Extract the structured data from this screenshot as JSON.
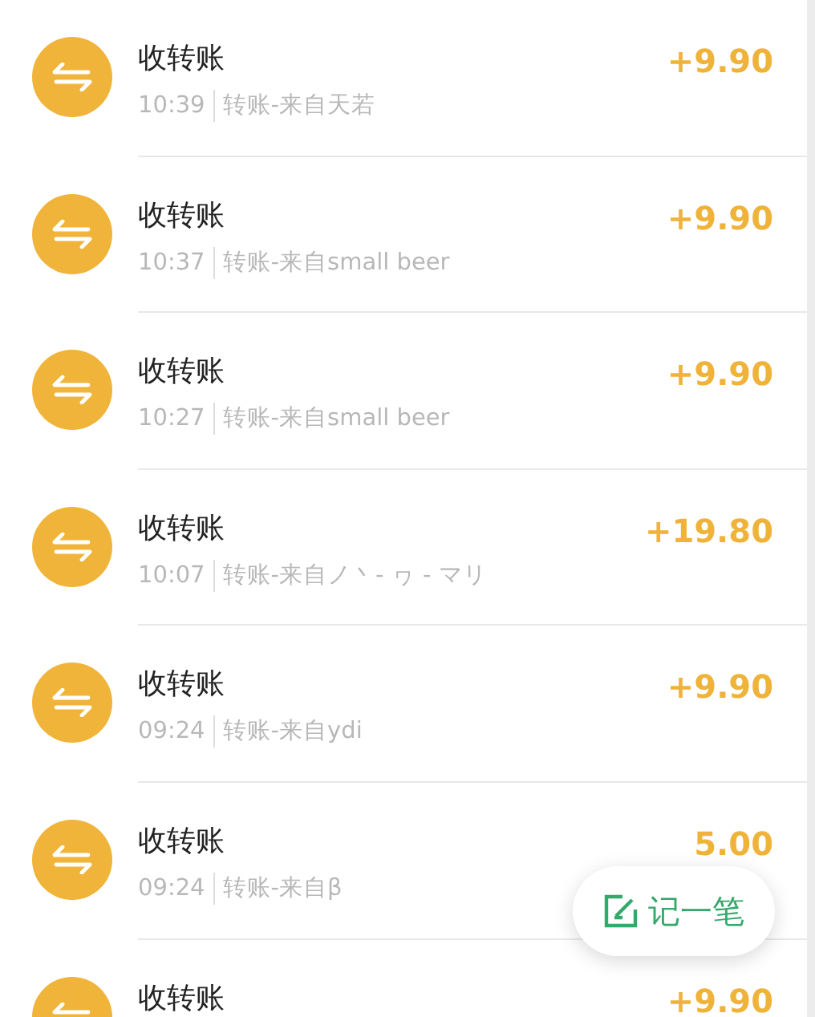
{
  "transactions": [
    {
      "title": "收转账",
      "time": "10:39",
      "description": "转账-来自天若",
      "amount": "+9.90"
    },
    {
      "title": "收转账",
      "time": "10:37",
      "description": "转账-来自small beer",
      "amount": "+9.90"
    },
    {
      "title": "收转账",
      "time": "10:27",
      "description": "转账-来自small beer",
      "amount": "+9.90"
    },
    {
      "title": "收转账",
      "time": "10:07",
      "description": "转账-来自ノ丶- ヮ - マリ",
      "amount": "+19.80"
    },
    {
      "title": "收转账",
      "time": "09:24",
      "description": "转账-来自ydi",
      "amount": "+9.90"
    },
    {
      "title": "收转账",
      "time": "09:24",
      "description": "转账-来自β",
      "amount": "5.00"
    },
    {
      "title": "收转账",
      "amount": "+9.90"
    }
  ],
  "record_button": {
    "label": "记一笔"
  }
}
